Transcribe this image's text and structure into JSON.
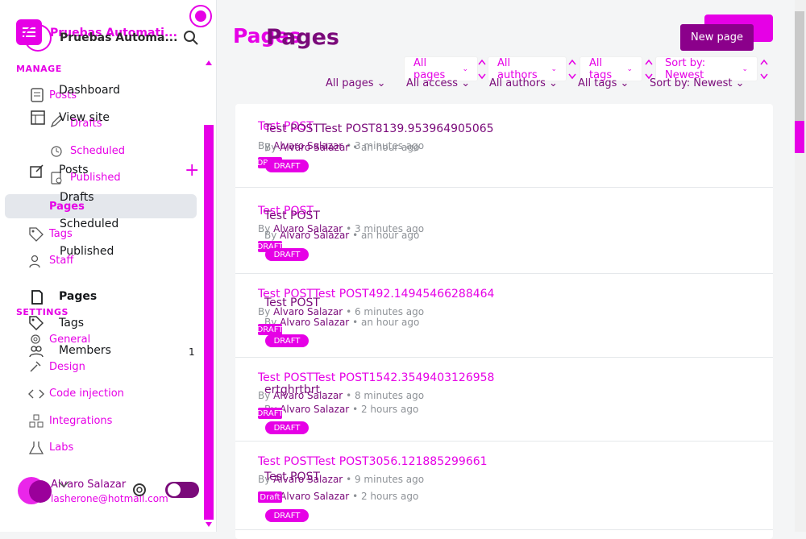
{
  "site": {
    "title_primary": "Pruebas Automati...",
    "title_secondary": "Pruebas Automa..."
  },
  "sidebar": {
    "manage_label": "MANAGE",
    "settings_label": "SETTINGS",
    "nav_ghost": {
      "posts": "Posts",
      "drafts": "Drafts",
      "scheduled": "Scheduled",
      "published": "Published",
      "pages": "Pages",
      "tags": "Tags",
      "staff": "Staff",
      "general": "General",
      "design": "Design",
      "code_injection": "Code injection",
      "integrations": "Integrations",
      "labs": "Labs"
    },
    "nav_main": {
      "dashboard": "Dashboard",
      "view_site": "View site",
      "posts": "Posts",
      "drafts": "Drafts",
      "scheduled": "Scheduled",
      "published": "Published",
      "pages": "Pages",
      "tags": "Tags",
      "members": "Members",
      "members_count": "1"
    },
    "user": {
      "name": "Alvaro Salazar",
      "email": "lasherone@hotmail.com"
    }
  },
  "header": {
    "title_ghost": "Pages",
    "title_main": "Pages",
    "new_page_label": "New page"
  },
  "filters_top": [
    "All pages",
    "All authors",
    "All tags",
    "Sort by: Newest"
  ],
  "filters_bottom": [
    "All pages",
    "All access",
    "All authors",
    "All tags",
    "Sort by: Newest"
  ],
  "rows": [
    {
      "title_a": "Test POST",
      "title_b": "Test POSTTest POST8139.953964905065",
      "meta_a_prefix": "By",
      "meta_a_author": "Alvaro Salazar",
      "meta_a_time": "• 3 minutes ago",
      "meta_b_prefix": "By",
      "meta_b_author": "Alvaro Salazar",
      "meta_b_time": "• an hour ago",
      "status_a": "DRAFT",
      "status_b": "DRAFT"
    },
    {
      "title_a": "Test POST",
      "title_b": "Test POST",
      "meta_a_prefix": "By",
      "meta_a_author": "Alvaro Salazar",
      "meta_a_time": "• 3 minutes ago",
      "meta_b_prefix": "By",
      "meta_b_author": "Alvaro Salazar",
      "meta_b_time": "• an hour ago",
      "status_a": "DRAFT",
      "status_b": "DRAFT"
    },
    {
      "title_a": "Test POSTTest POST492.14945466288464",
      "title_b": "Test POST",
      "meta_a_prefix": "By",
      "meta_a_author": "Alvaro Salazar",
      "meta_a_time": "• 6 minutes ago",
      "meta_b_prefix": "By",
      "meta_b_author": "Alvaro Salazar",
      "meta_b_time": "• an hour ago",
      "status_a": "DRAFT",
      "status_b": "DRAFT"
    },
    {
      "title_a": "Test POSTTest POST1542.3549403126958",
      "title_b": "ertghrtbrt",
      "meta_a_prefix": "By",
      "meta_a_author": "Alvaro Salazar",
      "meta_a_time": "• 8 minutes ago",
      "meta_b_prefix": "By",
      "meta_b_author": "Alvaro Salazar",
      "meta_b_time": "• 2 hours ago",
      "status_a": "DRAFT",
      "status_b": "DRAFT"
    },
    {
      "title_a": "Test POSTTest POST3056.121885299661",
      "title_b": "Test POST",
      "meta_a_prefix": "By",
      "meta_a_author": "Alvaro Salazar",
      "meta_a_time": "• 9 minutes ago",
      "meta_b_prefix": "By",
      "meta_b_author": "Alvaro Salazar",
      "meta_b_time": "• 2 hours ago",
      "status_a": "Draft",
      "status_b": "DRAFT"
    }
  ],
  "colors": {
    "accent": "#e600e6",
    "secondary": "#8b008b"
  }
}
